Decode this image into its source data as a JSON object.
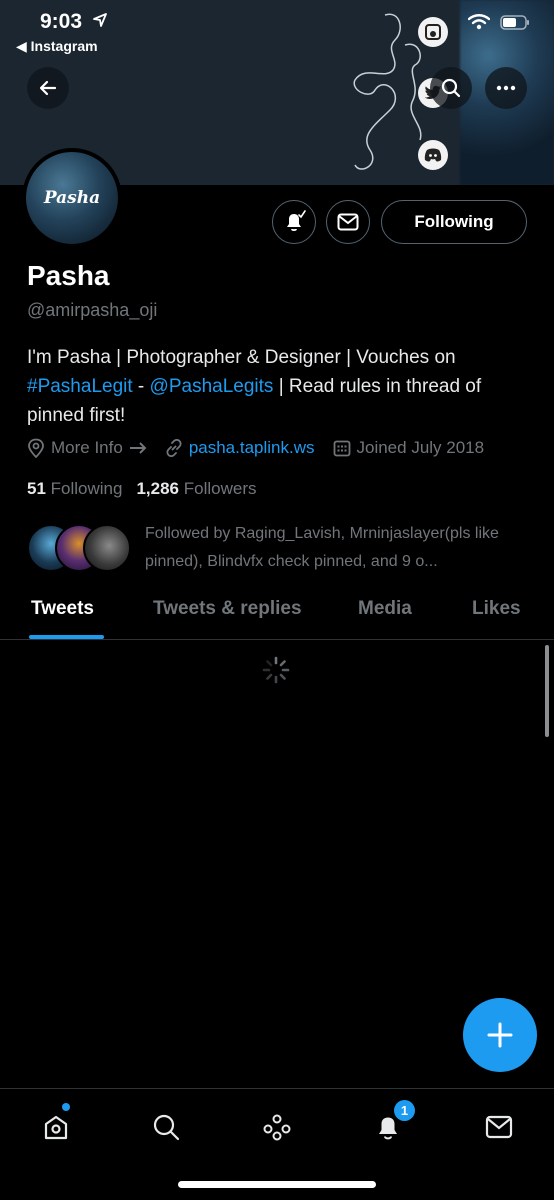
{
  "status": {
    "time": "9:03",
    "back_app": "◀ Instagram"
  },
  "profile": {
    "avatar_text": "Pasha",
    "name": "Pasha",
    "handle": "@amirpasha_oji",
    "bio_part1": "I'm Pasha | Photographer & Designer | Vouches on ",
    "bio_hashtag": "#PashaLegit",
    "bio_sep": " - ",
    "bio_mention": "@PashaLegits",
    "bio_part2": " | Read rules in thread of pinned first!",
    "more_info": "More Info",
    "website": "pasha.taplink.ws",
    "joined": "Joined July 2018",
    "following_count": "51",
    "following_label": "Following",
    "followers_count": "1,286",
    "followers_label": "Followers",
    "followed_by": "Followed by Raging_Lavish, Mrninjaslayer(pls like pinned), Blindvfx check pinned, and 9 o..."
  },
  "actions": {
    "following_button": "Following"
  },
  "tabs": [
    {
      "label": "Tweets",
      "active": true
    },
    {
      "label": "Tweets & replies",
      "active": false
    },
    {
      "label": "Media",
      "active": false
    },
    {
      "label": "Likes",
      "active": false
    }
  ],
  "nav": {
    "notifications_badge": "1"
  },
  "colors": {
    "accent": "#1d9bf0",
    "background": "#000000",
    "muted": "#71767b"
  }
}
